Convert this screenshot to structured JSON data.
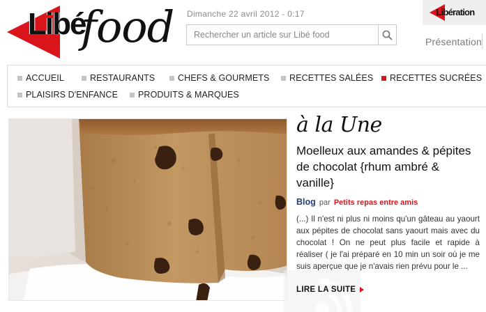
{
  "header": {
    "logo_libe": "Libé",
    "logo_food": "food",
    "date": "Dimanche 22 avril 2012 - 0:17",
    "search_placeholder": "Rechercher un article sur Libé food",
    "badge_text": "Libération",
    "presentation_link": "Présentation"
  },
  "nav": {
    "items": [
      {
        "label": "ACCUEIL",
        "active": false
      },
      {
        "label": "RESTAURANTS",
        "active": false
      },
      {
        "label": "CHEFS & GOURMETS",
        "active": false
      },
      {
        "label": "RECETTES SALÉES",
        "active": false
      },
      {
        "label": "RECETTES SUCRÉES",
        "active": true
      },
      {
        "label": "PLAISIRS D'ENFANCE",
        "active": false
      },
      {
        "label": "PRODUITS & MARQUES",
        "active": false
      }
    ]
  },
  "featured": {
    "section_title": "à la Une",
    "article_title": "Moelleux aux amandes & pépites de chocolat {rhum ambré & vanille}",
    "byline_type": "Blog",
    "byline_par": "par",
    "byline_author": "Petits repas entre amis",
    "excerpt": "(...) Il n'est ni plus ni moins qu'un gâteau au yaourt aux pépites de chocolat sans yaourt mais avec du chocolat ! On ne peut plus facile et rapide à réaliser ( je l'ai préparé en 10 min un soir où je me suis aperçue que je n'avais rien prévu pour le ...",
    "read_more": "LIRE LA SUITE"
  },
  "colors": {
    "brand_red": "#d9141b",
    "link_blue": "#1f3e7a",
    "nav_square": "#c4c4c4"
  },
  "icons": [
    "search-icon",
    "arrow-right-icon"
  ]
}
